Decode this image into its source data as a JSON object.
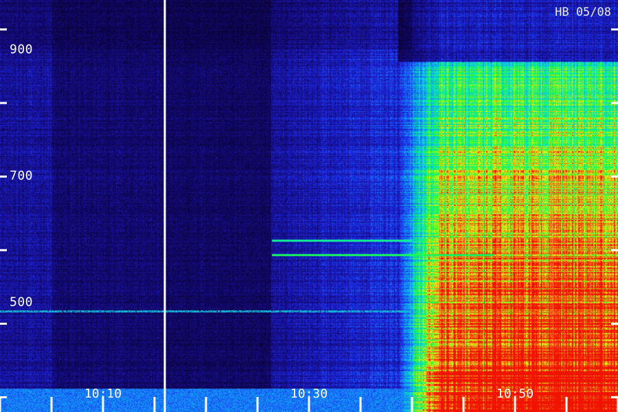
{
  "title": "HB 05/08",
  "y_axis": {
    "labels": [
      "900",
      "700",
      "500"
    ],
    "label_values": [
      900,
      700,
      500
    ],
    "tick_values": [
      400,
      500,
      600,
      700,
      800,
      900
    ],
    "range": [
      380,
      940
    ]
  },
  "x_axis": {
    "labels": [
      "10:10",
      "10:30",
      "10:50"
    ],
    "label_times_min": [
      10,
      30,
      50
    ]
  },
  "colors": {
    "background": "#050018",
    "axis": "#ffffff"
  }
}
